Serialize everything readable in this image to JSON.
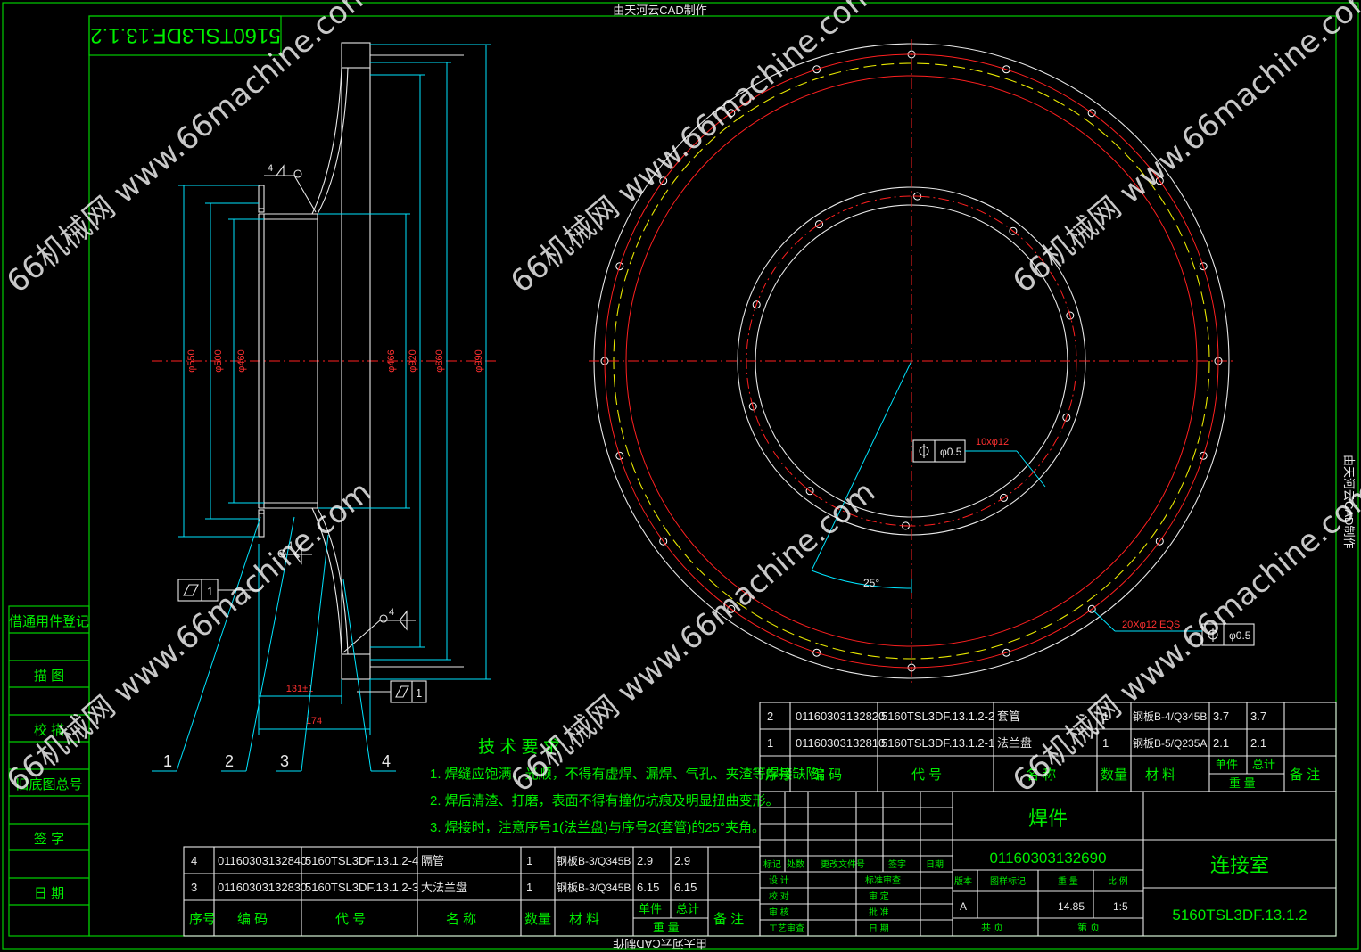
{
  "title_top": "由天河云CAD制作",
  "title_side": "由天河云CAD制作",
  "title_bottom": "由天河云CAD制作",
  "drawing_no_mirrored": "5160TSL3DF.13.1.2",
  "watermark": "66机械网 www.66machine.com",
  "dims": {
    "d550": "φ550",
    "d500": "φ500",
    "d460": "φ460",
    "d466": "φ466",
    "d920": "φ920",
    "d860": "φ860",
    "d990": "φ990",
    "l131": "131±1",
    "l174": "174",
    "weld4": "4",
    "flat1": "1",
    "holes_small": "10xφ12",
    "holes_big": "20Xφ12 EQS",
    "tol": "φ0.5",
    "angle": "25°"
  },
  "balloons": [
    "1",
    "2",
    "3",
    "4"
  ],
  "tech": {
    "heading": "技 术 要 求",
    "items": [
      "1. 焊缝应饱满、光顺，不得有虚焊、漏焊、气孔、夹渣等焊接缺陷；",
      "2. 焊后清渣、打磨，表面不得有撞伤坑痕及明显扭曲变形。",
      "3. 焊接时，注意序号1(法兰盘)与序号2(套管)的25°夹角。"
    ]
  },
  "left_sidebar": [
    "借通用件登记",
    "描 图",
    "校 描",
    "旧底图总号",
    "签 字",
    "日 期"
  ],
  "bom_right": {
    "rows": [
      [
        "2",
        "01160303132820",
        "5160TSL3DF.13.1.2-2",
        "套管",
        "1",
        "钢板B-4/Q345B",
        "3.7",
        "3.7",
        ""
      ],
      [
        "1",
        "01160303132810",
        "5160TSL3DF.13.1.2-1",
        "法兰盘",
        "1",
        "钢板B-5/Q235A",
        "2.1",
        "2.1",
        ""
      ]
    ],
    "header": [
      "序号",
      "编 码",
      "代 号",
      "名 称",
      "数量",
      "材 料",
      "单件",
      "总计",
      "备 注"
    ],
    "weight_label": "重 量"
  },
  "bom_left": {
    "rows": [
      [
        "4",
        "01160303132840",
        "5160TSL3DF.13.1.2-4",
        "隔管",
        "1",
        "钢板B-3/Q345B",
        "2.9",
        "2.9",
        ""
      ],
      [
        "3",
        "01160303132830",
        "5160TSL3DF.13.1.2-3",
        "大法兰盘",
        "1",
        "钢板B-3/Q345B",
        "6.15",
        "6.15",
        ""
      ]
    ],
    "header": [
      "序号",
      "编 码",
      "代 号",
      "名 称",
      "数量",
      "材 料",
      "单件",
      "总计",
      "备 注"
    ],
    "weight_label": "重 量"
  },
  "title_block": {
    "type": "焊件",
    "code": "01160303132690",
    "name": "连接室",
    "number": "5160TSL3DF.13.1.2",
    "rev_labels": [
      "标记",
      "处数",
      "更改文件号",
      "签字",
      "日期"
    ],
    "sign_left": [
      "设 计",
      "校 对",
      "审 核",
      "工艺审查"
    ],
    "sign_mid": [
      "标准审查",
      "审 定",
      "批 准",
      "日 期"
    ],
    "info_headers": [
      "版本",
      "图样标记",
      "重 量",
      "比 例"
    ],
    "version": "A",
    "weight": "14.85",
    "scale": "1:5",
    "sheets": "共 页",
    "page": "第 页"
  }
}
